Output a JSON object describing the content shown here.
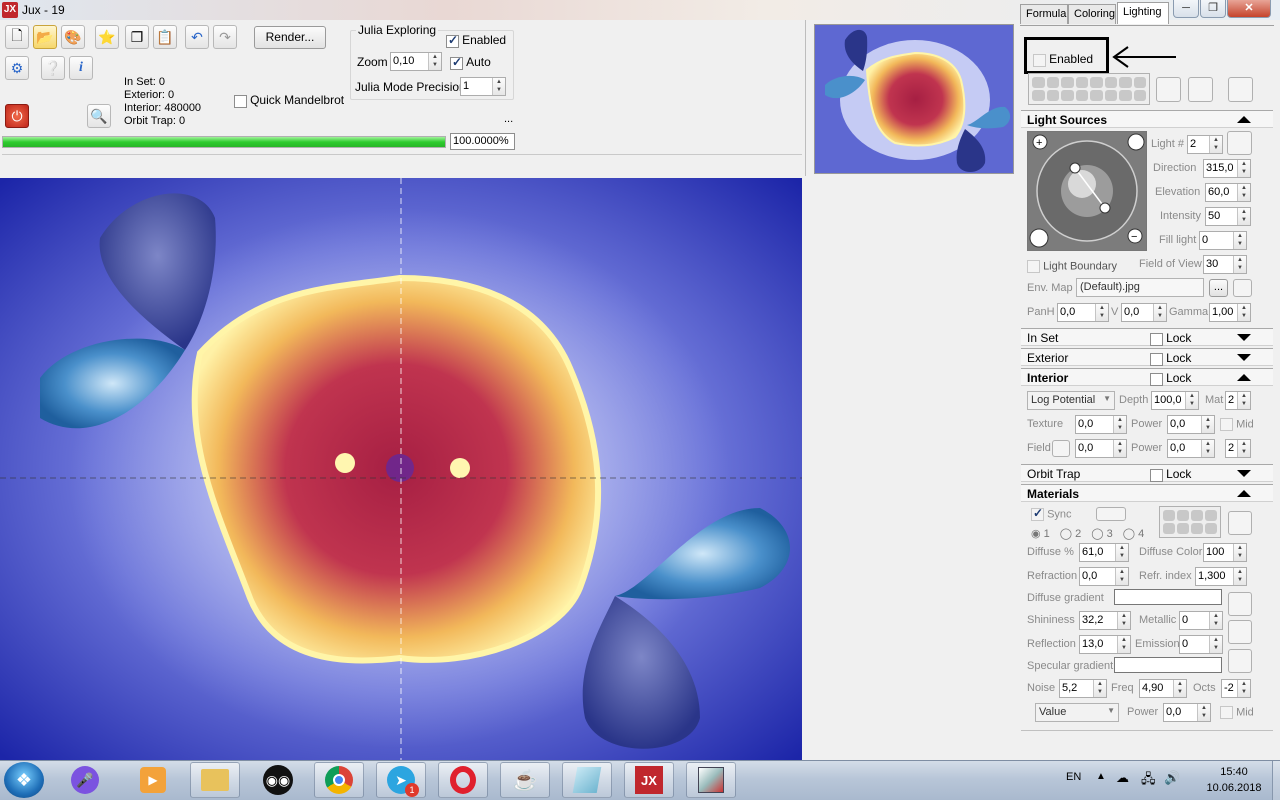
{
  "window": {
    "title": "Jux - 19",
    "app_icon": "JX"
  },
  "toolbar": {
    "render_label": "Render...",
    "stats": {
      "in_set": "In Set: 0",
      "exterior": "Exterior: 0",
      "interior": "Interior: 480000",
      "orbit_trap": "Orbit Trap: 0"
    },
    "quick_mandelbrot": "Quick Mandelbrot",
    "progress_value": 1.0,
    "progress_text": "100.0000%",
    "ellipsis": "..."
  },
  "julia": {
    "group_label": "Julia Exploring",
    "enabled_label": "Enabled",
    "zoom_label": "Zoom",
    "zoom_value": "0,10",
    "auto_label": "Auto",
    "precision_label": "Julia Mode Precision",
    "precision_value": "1"
  },
  "tabs": [
    "Formula",
    "Coloring",
    "Lighting"
  ],
  "lighting": {
    "enabled_label": "Enabled",
    "light_sources": "Light Sources",
    "light_no_label": "Light #",
    "light_no": "2",
    "direction_label": "Direction",
    "direction": "315,0",
    "elevation_label": "Elevation",
    "elevation": "60,0",
    "intensity_label": "Intensity",
    "intensity": "50",
    "fill_label": "Fill light",
    "fill": "0",
    "light_boundary": "Light Boundary",
    "fov_label": "Field of View",
    "fov": "30",
    "env_map_label": "Env. Map",
    "env_map": "(Default).jpg",
    "env_browse": "...",
    "panh_label": "PanH",
    "panh": "0,0",
    "v_label": "V",
    "v": "0,0",
    "gamma_label": "Gamma",
    "gamma": "1,00"
  },
  "sections": {
    "in_set": "In Set",
    "exterior": "Exterior",
    "interior": "Interior",
    "orbit_trap": "Orbit Trap",
    "materials": "Materials",
    "lock": "Lock"
  },
  "interior": {
    "mode": "Log Potential",
    "depth_label": "Depth",
    "depth": "100,0",
    "mat_label": "Mat",
    "mat": "2",
    "texture_label": "Texture",
    "texture": "0,0",
    "power_label": "Power",
    "power": "0,0",
    "mid_label": "Mid",
    "field_label": "Field",
    "field": "0,0",
    "power2": "0,0",
    "mat2": "2"
  },
  "materials": {
    "sync_label": "Sync",
    "radios": [
      "1",
      "2",
      "3",
      "4"
    ],
    "diffuse_label": "Diffuse %",
    "diffuse": "61,0",
    "diffuse_color_label": "Diffuse Color",
    "diffuse_color": "100",
    "refraction_label": "Refraction",
    "refraction": "0,0",
    "refr_index_label": "Refr. index",
    "refr_index": "1,300",
    "diffuse_gradient_label": "Diffuse gradient",
    "shininess_label": "Shininess",
    "shininess": "32,2",
    "metallic_label": "Metallic",
    "metallic": "0",
    "reflection_label": "Reflection",
    "reflection": "13,0",
    "emission_label": "Emission",
    "emission": "0",
    "specular_gradient_label": "Specular gradient",
    "noise_label": "Noise",
    "noise": "5,2",
    "freq_label": "Freq",
    "freq": "4,90",
    "octs_label": "Octs",
    "octs": "-2",
    "value_select": "Value",
    "power_label": "Power",
    "power": "0,0",
    "mid_label": "Mid"
  },
  "taskbar": {
    "lang": "EN",
    "time": "15:40",
    "date": "10.06.2018",
    "telegram_badge": "1"
  }
}
